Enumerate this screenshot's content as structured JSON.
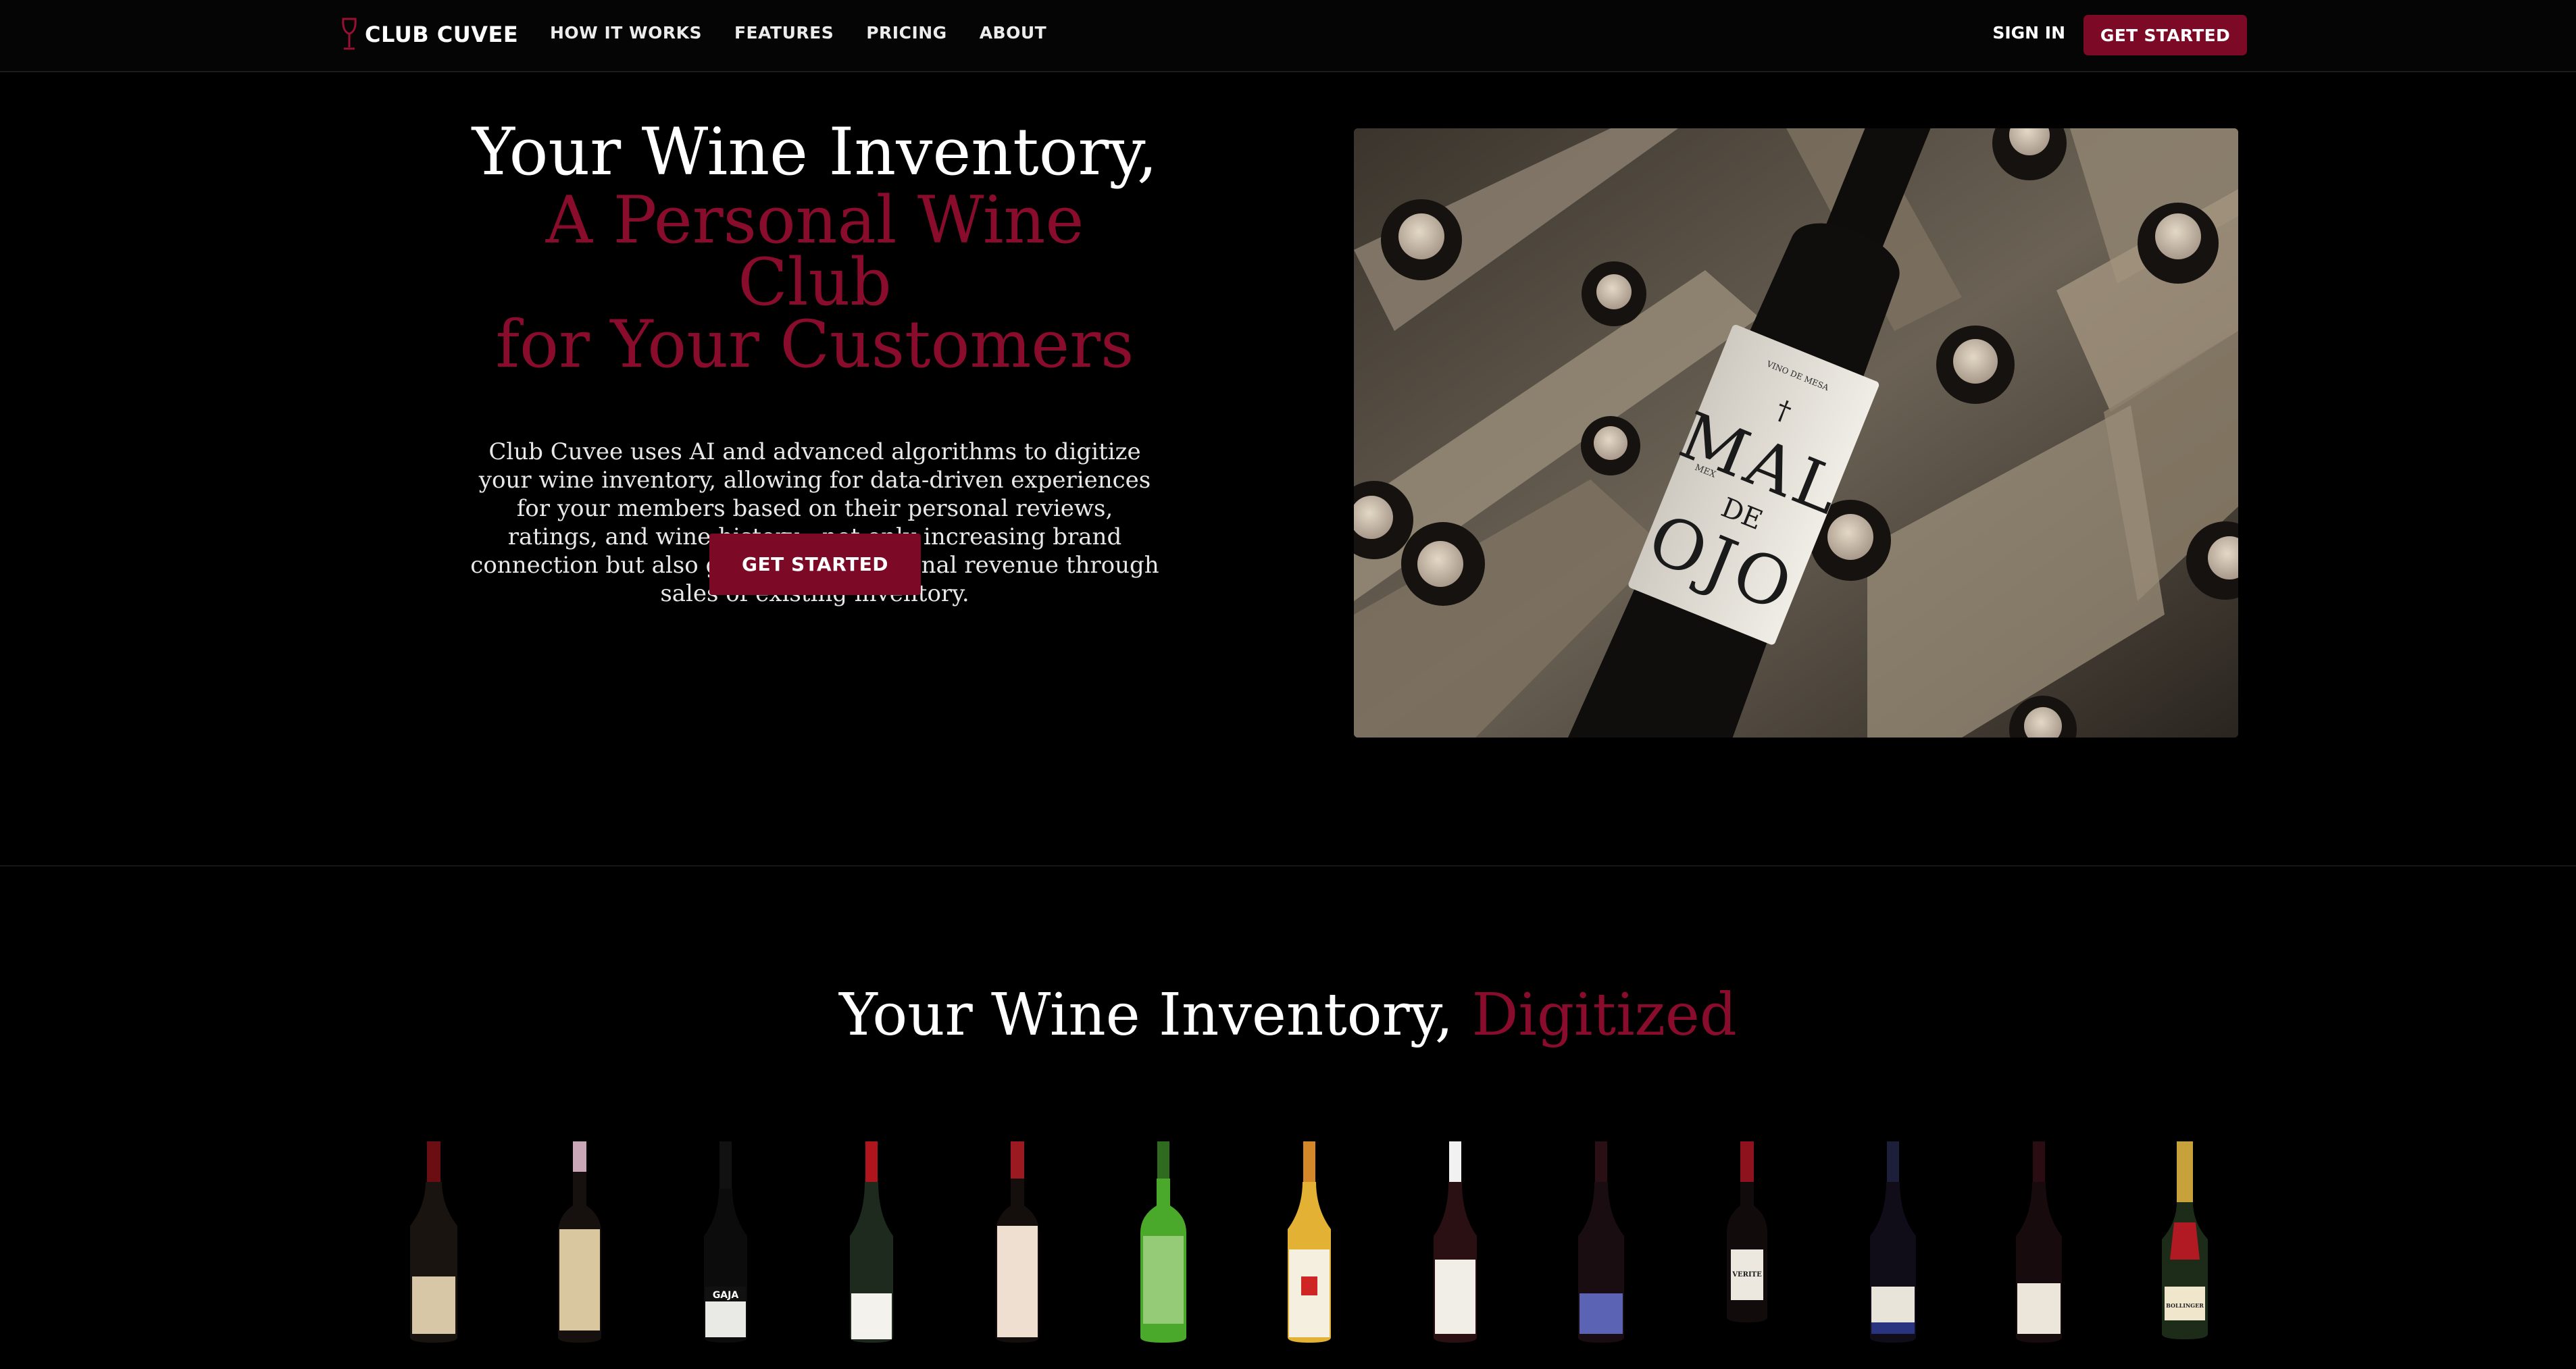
{
  "nav": {
    "brand": "CLUB CUVEE",
    "links": [
      "HOW IT WORKS",
      "FEATURES",
      "PRICING",
      "ABOUT"
    ],
    "sign_in": "SIGN IN",
    "cta": "GET STARTED"
  },
  "hero": {
    "title_line1": "Your Wine Inventory,",
    "title_line2": "A Personal Wine Club",
    "title_line3": "for Your Customers",
    "description": "Club Cuvee uses AI and advanced algorithms to digitize your wine inventory, allowing for data-driven experiences for your members based on their personal reviews, ratings, and wine history—not only increasing brand connection but also generating additional revenue through sales of existing inventory.",
    "cta": "GET STARTED",
    "image_label": {
      "top": "VINO DE MESA",
      "line1": "MAL",
      "line2": "DE",
      "line3": "OJO",
      "small": "MEX"
    }
  },
  "digitized": {
    "title_main": "Your Wine Inventory,",
    "title_accent": "Digitized"
  },
  "bottles": [
    {
      "label": ""
    },
    {
      "label": ""
    },
    {
      "label": "GAJA"
    },
    {
      "label": ""
    },
    {
      "label": ""
    },
    {
      "label": ""
    },
    {
      "label": ""
    },
    {
      "label": ""
    },
    {
      "label": ""
    },
    {
      "label": "VERITE"
    },
    {
      "label": ""
    },
    {
      "label": ""
    },
    {
      "label": "BOLLINGER"
    }
  ],
  "colors": {
    "accent": "#8a0c2c",
    "button": "#7c0a27",
    "background": "#000000"
  }
}
